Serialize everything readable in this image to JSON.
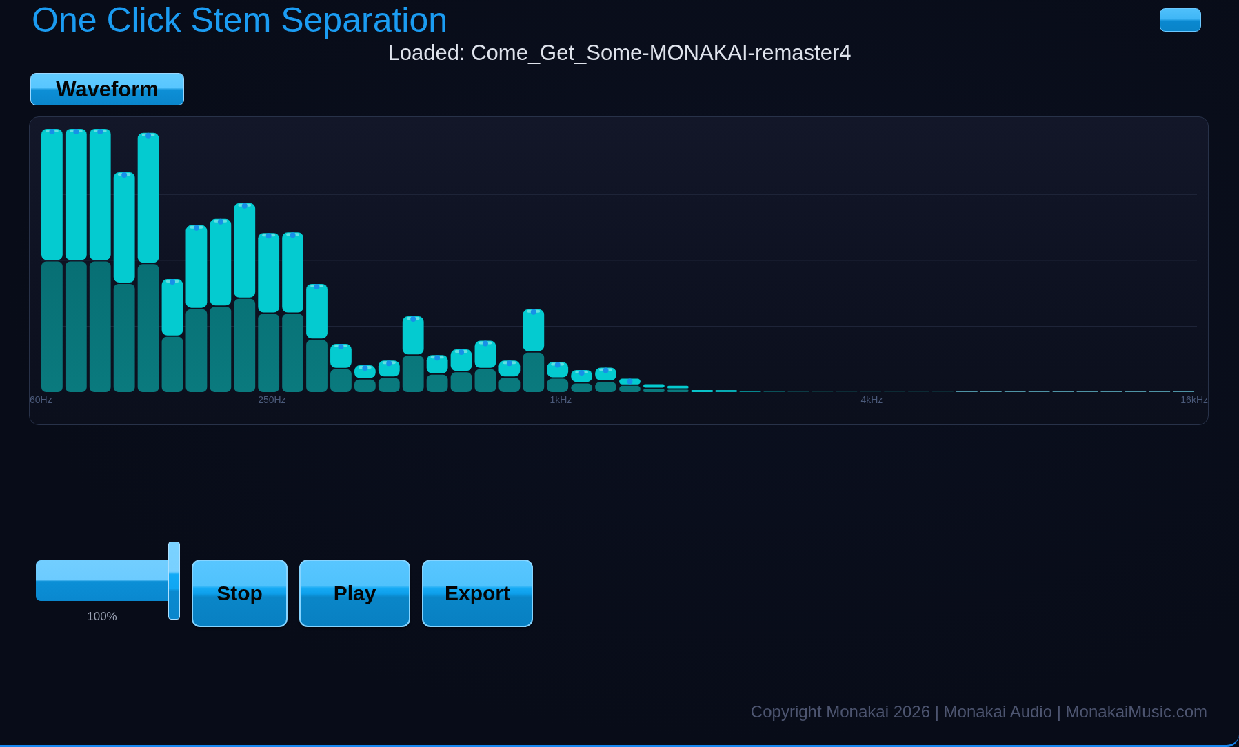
{
  "header": {
    "title": "One Click Stem Separation"
  },
  "status": {
    "loaded_file": "Loaded: Come_Get_Some-MONAKAI-remaster4"
  },
  "view_button": {
    "label": "Waveform"
  },
  "spectrum": {
    "axis_labels": [
      "60Hz",
      "250Hz",
      "1kHz",
      "4kHz",
      "16kHz"
    ]
  },
  "volume": {
    "level": 1,
    "reading": "100%"
  },
  "buttons": [
    "Stop",
    "Play",
    "Export"
  ],
  "footer": {
    "text": "Copyright Monakai 2026 | Monakai Audio | MonakaiMusic.com"
  }
}
